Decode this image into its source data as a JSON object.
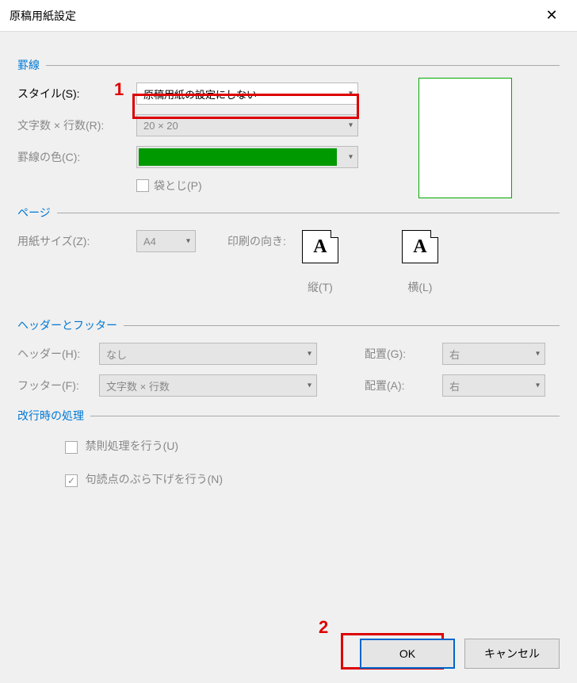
{
  "window": {
    "title": "原稿用紙設定"
  },
  "annotations": {
    "a1": "1",
    "a2": "2"
  },
  "sections": {
    "ruled": "罫線",
    "page": "ページ",
    "header_footer": "ヘッダーとフッター",
    "linebreak": "改行時の処理"
  },
  "style": {
    "label": "スタイル(S):",
    "value": "原稿用紙の設定にしない"
  },
  "chars_rows": {
    "label": "文字数 × 行数(R):",
    "value": "20 × 20"
  },
  "line_color": {
    "label": "罫線の色(C):",
    "value": "#009900"
  },
  "fold": {
    "label": "袋とじ(P)"
  },
  "paper_size": {
    "label": "用紙サイズ(Z):",
    "value": "A4"
  },
  "orientation": {
    "label": "印刷の向き:",
    "portrait": "縦(T)",
    "landscape": "横(L)"
  },
  "header": {
    "label": "ヘッダー(H):",
    "value": "なし",
    "align_label": "配置(G):",
    "align_value": "右"
  },
  "footer": {
    "label": "フッター(F):",
    "value": "文字数 × 行数",
    "align_label": "配置(A):",
    "align_value": "右"
  },
  "kinsoku": {
    "label": "禁則処理を行う(U)"
  },
  "punct_hang": {
    "label": "句読点のぶら下げを行う(N)"
  },
  "buttons": {
    "ok": "OK",
    "cancel": "キャンセル"
  }
}
